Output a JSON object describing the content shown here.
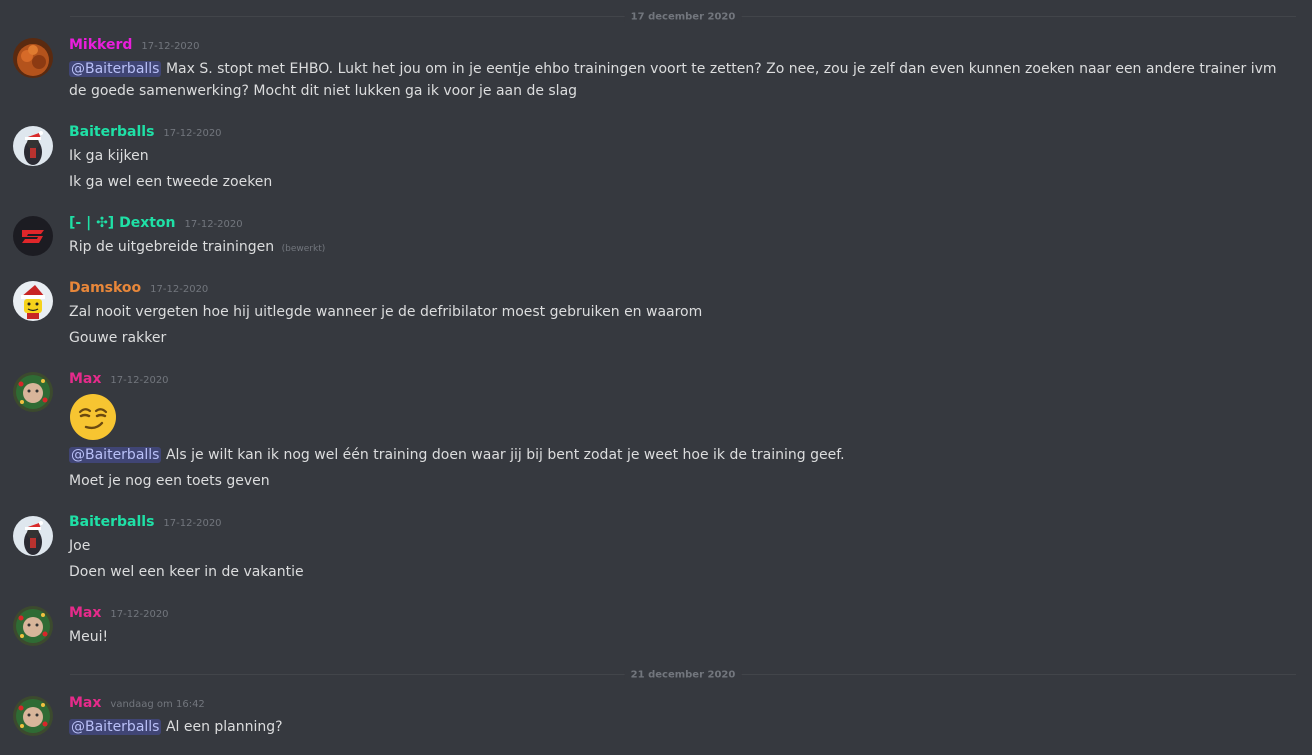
{
  "dividers": {
    "first": "17 december 2020",
    "second": "21 december 2020"
  },
  "colors": {
    "magenta": "#e91edb",
    "teal": "#1fe0a6",
    "orange": "#e8873a",
    "pink": "#e52b8b",
    "mention_text": "#b9c0f7"
  },
  "messages": [
    {
      "author": "Mikkerd",
      "timestamp": "17-12-2020",
      "avatar_icon": "fox-avatar-icon",
      "mention": "@Baiterballs",
      "lines": [
        "Max S. stopt met EHBO. Lukt het jou om in je eentje ehbo trainingen voort te zetten? Zo nee, zou je zelf dan even kunnen zoeken naar een andere trainer ivm de goede samenwerking? Mocht dit niet lukken ga ik voor je aan de slag"
      ]
    },
    {
      "author": "Baiterballs",
      "timestamp": "17-12-2020",
      "avatar_icon": "santa-hat-rider-avatar-icon",
      "lines": [
        "Ik ga kijken",
        "Ik ga wel een tweede zoeken"
      ]
    },
    {
      "author": "[- | ✣] Dexton",
      "timestamp": "17-12-2020",
      "avatar_icon": "red-s-logo-avatar-icon",
      "lines": [
        "Rip de uitgebreide trainingen"
      ],
      "edited": "(bewerkt)"
    },
    {
      "author": "Damskoo",
      "timestamp": "17-12-2020",
      "avatar_icon": "lego-santa-avatar-icon",
      "lines": [
        "Zal nooit vergeten hoe hij uitlegde wanneer je de defribilator moest gebruiken en waarom",
        "Gouwe rakker"
      ]
    },
    {
      "author": "Max",
      "timestamp": "17-12-2020",
      "avatar_icon": "christmas-wreath-avatar-icon",
      "emoji_icon": "smirking-face-icon",
      "mention": "@Baiterballs",
      "lines": [
        "Als je wilt kan ik nog wel één training doen waar jij bij bent zodat je weet hoe ik de training geef.",
        "Moet je nog een toets geven"
      ]
    },
    {
      "author": "Baiterballs",
      "timestamp": "17-12-2020",
      "avatar_icon": "santa-hat-rider-avatar-icon",
      "lines": [
        "Joe",
        "Doen wel een keer in de vakantie"
      ]
    },
    {
      "author": "Max",
      "timestamp": "17-12-2020",
      "avatar_icon": "christmas-wreath-avatar-icon",
      "lines": [
        "Meui!"
      ]
    },
    {
      "author": "Max",
      "timestamp": "vandaag om 16:42",
      "avatar_icon": "christmas-wreath-avatar-icon",
      "mention": "@Baiterballs",
      "lines": [
        "Al een planning?"
      ]
    }
  ]
}
